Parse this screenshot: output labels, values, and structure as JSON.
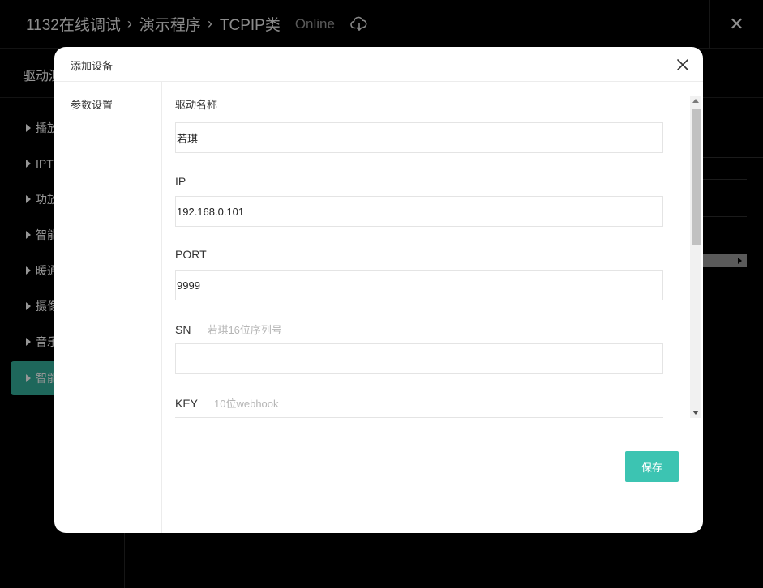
{
  "app": {
    "breadcrumb": [
      "1132在线调试",
      "演示程序",
      "TCPIP类"
    ],
    "status": "Online",
    "subtitle": "驱动测"
  },
  "nav": {
    "items": [
      {
        "label": "播放"
      },
      {
        "label": "IPT"
      },
      {
        "label": "功放"
      },
      {
        "label": "智能"
      },
      {
        "label": "暖通"
      },
      {
        "label": "摄像"
      },
      {
        "label": "音乐"
      },
      {
        "label": "智能"
      }
    ]
  },
  "modal": {
    "title": "添加设备",
    "side_item": "参数设置",
    "fields": {
      "name": {
        "label": "驱动名称",
        "value": "若琪"
      },
      "ip": {
        "label": "IP",
        "value": "192.168.0.101"
      },
      "port": {
        "label": "PORT",
        "value": "9999"
      },
      "sn": {
        "label": "SN",
        "hint": "若琪16位序列号",
        "value": ""
      },
      "key": {
        "label": "KEY",
        "hint": "10位webhook",
        "value": ""
      }
    },
    "save_label": "保存"
  },
  "colors": {
    "accent": "#3cc4b2",
    "nav_active": "#2e9e8c"
  }
}
